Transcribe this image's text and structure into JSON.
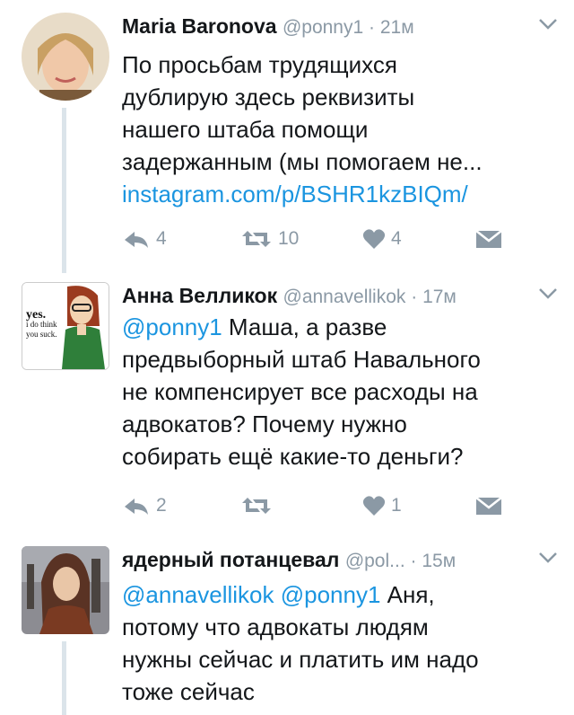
{
  "tweets": [
    {
      "author": "Maria Baronova",
      "handle": "@ponny1",
      "time": "21м",
      "text_lines": [
        "По просьбам трудящихся",
        "дублирую здесь реквизиты",
        "нашего штаба помощи",
        "задержанным (мы помогаем не..."
      ],
      "link": "instagram.com/p/BSHR1kzBIQm/",
      "reply_count": "4",
      "retweet_count": "10",
      "like_count": "4"
    },
    {
      "author": "Анна Велликок",
      "handle": "@annavellikok",
      "time": "17м",
      "mention": "@ponny1",
      "text_first": " Маша, а разве",
      "text_lines": [
        "предвыборный штаб Навального",
        "не компенсирует  все расходы на",
        "адвокатов? Почему нужно",
        "собирать ещё какие-то деньги?"
      ],
      "avatar_text": [
        "yes.",
        "i do think",
        "you suck."
      ],
      "reply_count": "2",
      "retweet_count": "",
      "like_count": "1"
    },
    {
      "author": "ядерный потанцевал",
      "handle": "@pol...",
      "time": "15м",
      "mention1": "@annavellikok",
      "mention2": "@ponny1",
      "text_first": " Аня,",
      "text_lines": [
        "потому что адвокаты людям",
        "нужны сейчас и платить им надо",
        "тоже сейчас"
      ]
    }
  ],
  "colors": {
    "accent": "#1b95e0",
    "muted": "#8b99a5",
    "line": "#dbe4ea"
  },
  "icons": [
    "reply-icon",
    "retweet-icon",
    "like-icon",
    "dm-icon",
    "chevron-down-icon"
  ]
}
